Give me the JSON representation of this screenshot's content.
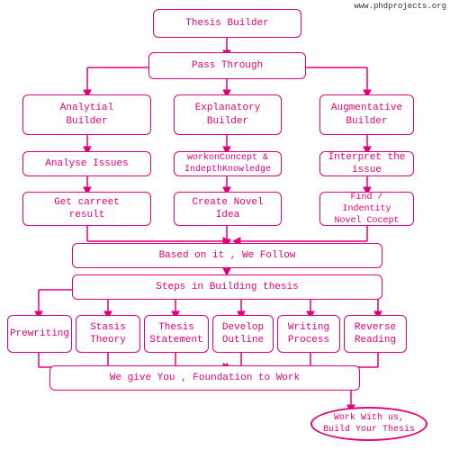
{
  "watermark": "www.phdprojects.org",
  "boxes": {
    "thesis_builder": {
      "label": "Thesis Builder"
    },
    "pass_through": {
      "label": "Pass  Through"
    },
    "analytical_builder": {
      "label": "Analytial\nBuilder"
    },
    "explanatory_builder": {
      "label": "Explanatory\nBuilder"
    },
    "augmentative_builder": {
      "label": "Augmentative\nBuilder"
    },
    "analyse_issues": {
      "label": "Analyse Issues"
    },
    "workon_concept": {
      "label": "workonConcept &\nIndepthKnowledge"
    },
    "interpret_issue": {
      "label": "Interpret the\nissue"
    },
    "get_carret": {
      "label": "Get carreet\nresult"
    },
    "create_novel": {
      "label": "Create Novel\nIdea"
    },
    "find_indentity": {
      "label": "Find / Indentity\nNovel Cocept"
    },
    "based_on_it": {
      "label": "Based on it , We Follow"
    },
    "steps_building": {
      "label": "Steps in Building thesis"
    },
    "prewriting": {
      "label": "Prewriting"
    },
    "stasis_theory": {
      "label": "Stasis\nTheory"
    },
    "thesis_statement": {
      "label": "Thesis\nStatement"
    },
    "develop_outline": {
      "label": "Develop\nOutline"
    },
    "writing_process": {
      "label": "Writing\nProcess"
    },
    "reverse_reading": {
      "label": "Reverse\nReading"
    },
    "foundation": {
      "label": "We give You , Foundation to Work"
    },
    "work_with_us": {
      "label": "Work With us,\nBuild Your Thesis"
    }
  }
}
